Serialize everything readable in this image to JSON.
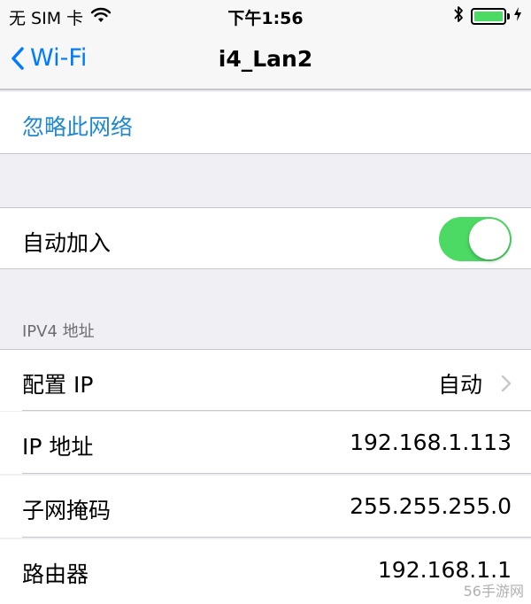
{
  "status_bar": {
    "carrier": "无 SIM 卡",
    "time": "下午1:56",
    "wifi_icon": "wifi-icon",
    "bluetooth_icon": "bluetooth-icon",
    "battery_level": 1.0,
    "battery_color": "#4cd964"
  },
  "nav": {
    "back_label": "Wi-Fi",
    "title": "i4_Lan2"
  },
  "forget": {
    "label": "忽略此网络"
  },
  "auto_join": {
    "label": "自动加入",
    "enabled": true,
    "on_color": "#4cd964"
  },
  "ipv4": {
    "header": "IPV4 地址",
    "configure_ip": {
      "label": "配置 IP",
      "value": "自动"
    },
    "ip_address": {
      "label": "IP 地址",
      "value": "192.168.1.113"
    },
    "subnet_mask": {
      "label": "子网掩码",
      "value": "255.255.255.0"
    },
    "router": {
      "label": "路由器",
      "value": "192.168.1.1"
    }
  },
  "watermark": "56手游网",
  "colors": {
    "accent": "#007aff",
    "link": "#1e88d2",
    "background": "#efeff4"
  }
}
